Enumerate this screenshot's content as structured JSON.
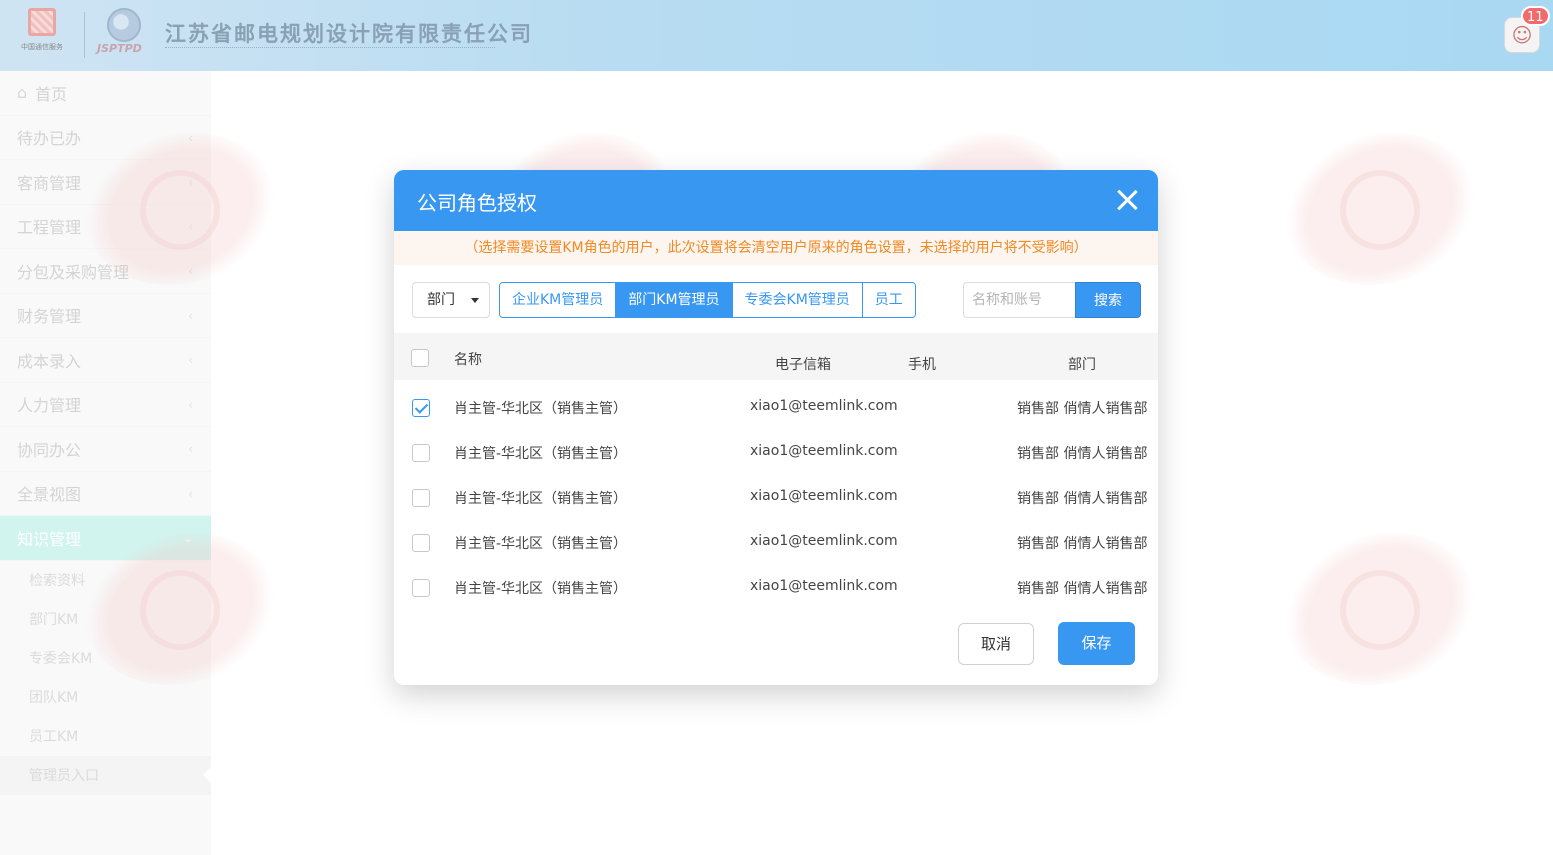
{
  "header": {
    "logo1_caption": "中国通信服务",
    "logo2_caption": "JSPTPD",
    "company_name": "江苏省邮电规划设计院有限责任公司",
    "notification_count": "11"
  },
  "sidebar": {
    "items": [
      {
        "label": "首页"
      },
      {
        "label": "待办已办"
      },
      {
        "label": "客商管理"
      },
      {
        "label": "工程管理"
      },
      {
        "label": "分包及采购管理"
      },
      {
        "label": "财务管理"
      },
      {
        "label": "成本录入"
      },
      {
        "label": "人力管理"
      },
      {
        "label": "协同办公"
      },
      {
        "label": "全景视图"
      },
      {
        "label": "知识管理"
      }
    ],
    "sub_items": [
      {
        "label": "检索资料"
      },
      {
        "label": "部门KM"
      },
      {
        "label": "专委会KM"
      },
      {
        "label": "团队KM"
      },
      {
        "label": "员工KM"
      },
      {
        "label": "管理员入口"
      }
    ]
  },
  "dialog": {
    "title": "公司角色授权",
    "notice": "（选择需要设置KM角色的用户，此次设置将会清空用户原来的角色设置，未选择的用户将不受影响）",
    "dept_select": "部门",
    "roles": [
      {
        "label": "企业KM管理员"
      },
      {
        "label": "部门KM管理员"
      },
      {
        "label": "专委会KM管理员"
      },
      {
        "label": "员工"
      }
    ],
    "active_role_index": 1,
    "search_placeholder": "名称和账号",
    "search_label": "搜索",
    "columns": {
      "name": "名称",
      "email": "电子信箱",
      "phone": "手机",
      "dept": "部门"
    },
    "rows": [
      {
        "name": "肖主管-华北区（销售主管）",
        "email": "xiao1@teemlink.com",
        "phone": "",
        "dept": "销售部 俏情人销售部",
        "checked": true
      },
      {
        "name": "肖主管-华北区（销售主管）",
        "email": "xiao1@teemlink.com",
        "phone": "",
        "dept": "销售部 俏情人销售部",
        "checked": false
      },
      {
        "name": "肖主管-华北区（销售主管）",
        "email": "xiao1@teemlink.com",
        "phone": "",
        "dept": "销售部 俏情人销售部",
        "checked": false
      },
      {
        "name": "肖主管-华北区（销售主管）",
        "email": "xiao1@teemlink.com",
        "phone": "",
        "dept": "销售部 俏情人销售部",
        "checked": false
      },
      {
        "name": "肖主管-华北区（销售主管）",
        "email": "xiao1@teemlink.com",
        "phone": "",
        "dept": "销售部 俏情人销售部",
        "checked": false
      }
    ],
    "cancel_label": "取消",
    "save_label": "保存"
  },
  "colors": {
    "primary": "#3897f0",
    "notice_text": "#ef8a25",
    "notice_bg": "#fdf5ef",
    "sidebar_active": "#b9efe7",
    "badge": "#f26b6b"
  },
  "icons": {
    "home": "home-icon",
    "chevron": "chevron-left-icon",
    "close": "close-icon",
    "caret": "caret-down-icon"
  }
}
